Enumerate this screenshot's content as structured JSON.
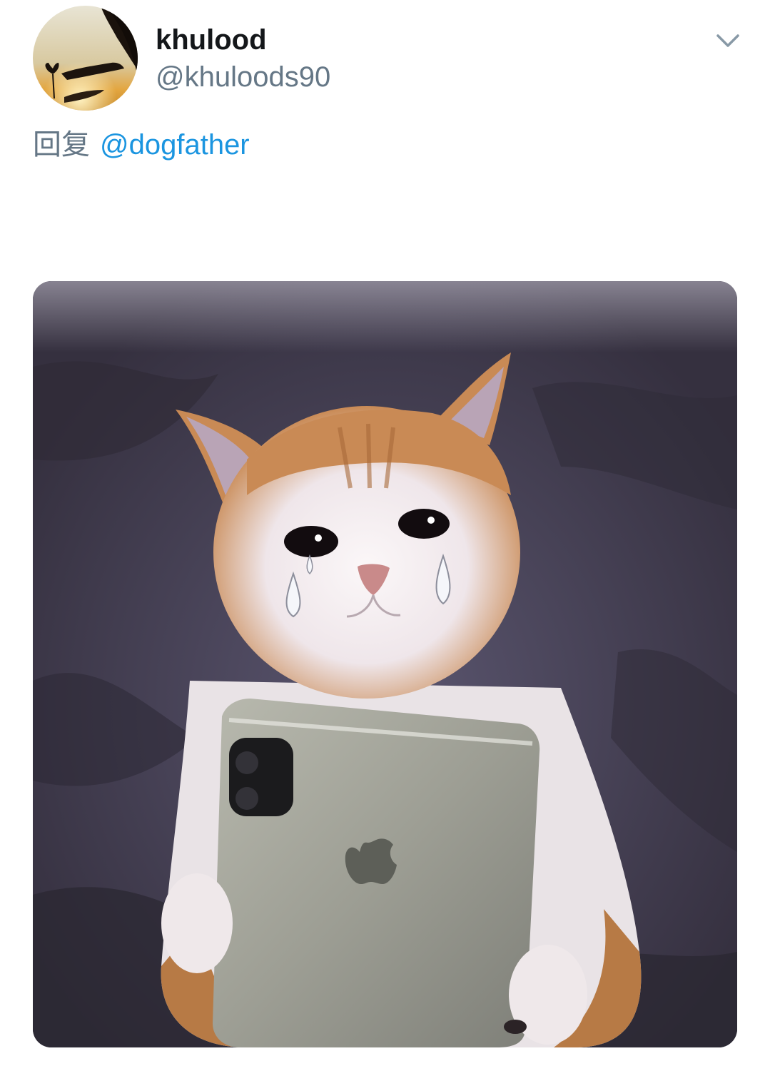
{
  "tweet": {
    "author": {
      "display_name": "khulood",
      "handle": "@khuloods90",
      "avatar_icon": "avatar-silhouette-image"
    },
    "reply": {
      "prefix": "回复",
      "mention": "@dogfather"
    },
    "menu_icon": "chevron-down-icon",
    "media": {
      "kind": "photo",
      "subject": "crying-cat-holding-phone-image"
    },
    "colors": {
      "name": "#14171a",
      "secondary": "#657786",
      "link": "#1b95e0"
    }
  }
}
